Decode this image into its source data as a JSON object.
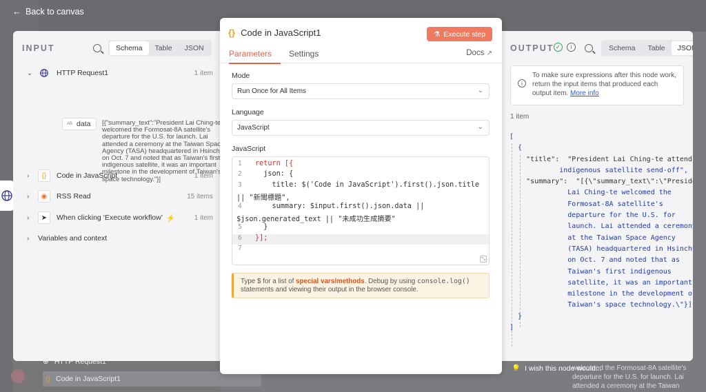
{
  "nav": {
    "back_label": "Back to canvas"
  },
  "background": {
    "list_items": [
      "HTTP Request1",
      "Code in JavaScript1"
    ],
    "right_text": "welcomed the Formosat-8A satellite's departure for the U.S. for launch. Lai attended a ceremony at the Taiwan"
  },
  "input": {
    "title": "INPUT",
    "view_tabs": [
      "Schema",
      "Table",
      "JSON"
    ],
    "active_view": "Schema",
    "nodes": [
      {
        "name": "HTTP Request1",
        "count": "1 item",
        "icon": "globe-icon",
        "expanded": true
      },
      {
        "name": "Code in JavaScript",
        "count": "1 item",
        "icon": "braces-icon",
        "expanded": false
      },
      {
        "name": "RSS Read",
        "count": "15 items",
        "icon": "rss-icon",
        "expanded": false
      },
      {
        "name": "When clicking ‘Execute workflow’",
        "count": "1 item",
        "icon": "cursor-icon",
        "expanded": false
      }
    ],
    "field": {
      "type_badge": "AB",
      "name": "data",
      "value": "[{\"summary_text\":\"President Lai Ching-te welcomed the Formosat-8A satellite's departure for the U.S. for launch. Lai attended a ceremony at the Taiwan Space Agency (TASA) headquartered in Hsinchu on Oct. 7 and noted that as Taiwan's first indigenous satellite, it was an important milestone in the development of Taiwan's space technology.\"}]"
    },
    "variables_label": "Variables and context"
  },
  "node": {
    "title": "Code in JavaScript1",
    "execute_label": "Execute step",
    "tabs": [
      "Parameters",
      "Settings"
    ],
    "active_tab": "Parameters",
    "docs_label": "Docs",
    "mode_label": "Mode",
    "mode_value": "Run Once for All Items",
    "language_label": "Language",
    "language_value": "JavaScript",
    "code_label": "JavaScript",
    "code_lines": [
      {
        "n": "1",
        "text": "return [{"
      },
      {
        "n": "2",
        "text": "  json: {"
      },
      {
        "n": "3",
        "text": "    title: $('Code in JavaScript').first().json.title"
      },
      {
        "n": "",
        "text": "|| \"新聞標題\","
      },
      {
        "n": "4",
        "text": "    summary: $input.first().json.data ||"
      },
      {
        "n": "",
        "text": "$json.generated_text || \"未成功生成摘要\""
      },
      {
        "n": "5",
        "text": "  }"
      },
      {
        "n": "6",
        "text": "}];"
      },
      {
        "n": "7",
        "text": ""
      }
    ],
    "hint": {
      "pre": "Type $ for a list of ",
      "link": "special vars/methods",
      "mid": ". Debug by using ",
      "code": "console.log()",
      "post": " statements and viewing their output in the browser console."
    }
  },
  "output": {
    "title": "OUTPUT",
    "view_tabs": [
      "Schema",
      "Table",
      "JSON"
    ],
    "active_view": "JSON",
    "info_text": "To make sure expressions after this node work, return the input items that produced each output item.",
    "info_link": "More info",
    "count": "1 item",
    "json_lines": [
      "[",
      "  {",
      "    \"title\":  \"President Lai Ching-te attends",
      "            indigenous satellite send-off\",",
      "    \"summary\":  \"[{\\\"summary_text\\\":\\\"President",
      "              Lai Ching-te welcomed the",
      "              Formosat-8A satellite's",
      "              departure for the U.S. for",
      "              launch. Lai attended a ceremony",
      "              at the Taiwan Space Agency",
      "              (TASA) headquartered in Hsinchu",
      "              on Oct. 7 and noted that as",
      "              Taiwan's first indigenous",
      "              satellite, it was an important",
      "              milestone in the development of",
      "              Taiwan's space technology.\\\"}]\"",
      "  }",
      "]"
    ],
    "feedback_label": "I wish this node would..."
  }
}
